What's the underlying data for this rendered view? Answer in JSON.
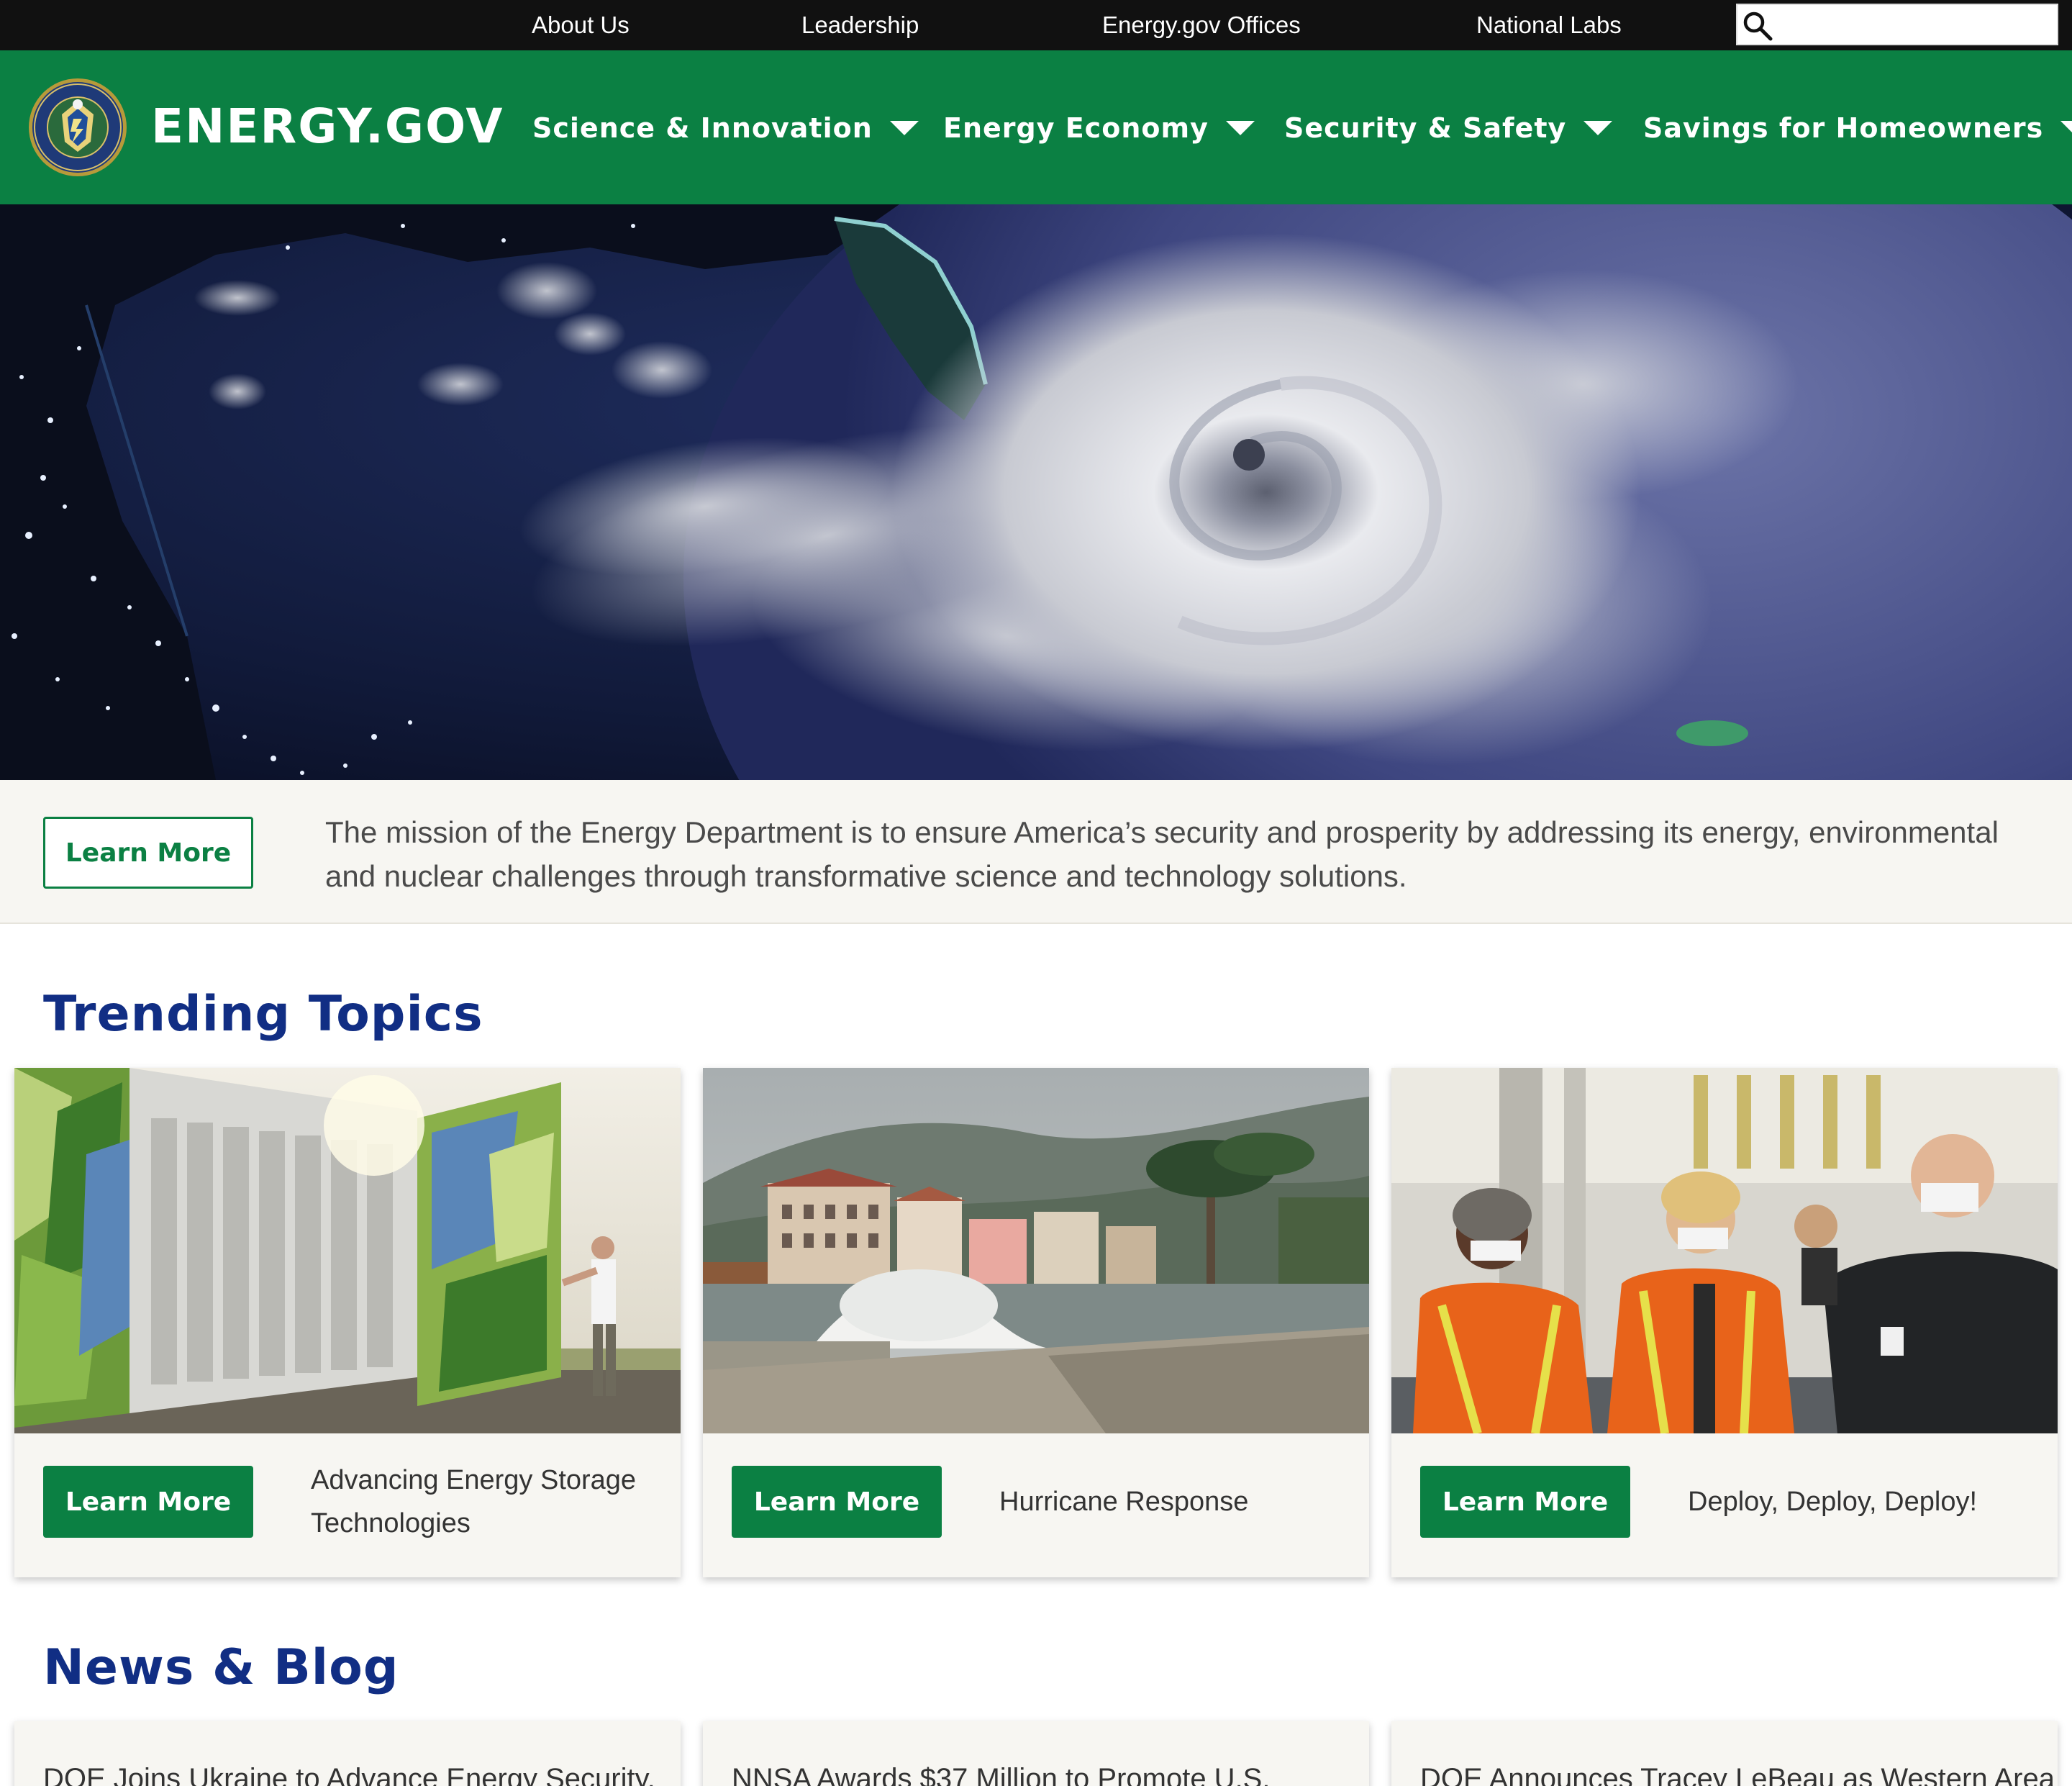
{
  "utility_nav": {
    "items": [
      "About Us",
      "Leadership",
      "Energy.gov Offices",
      "National Labs"
    ],
    "search_placeholder": ""
  },
  "header": {
    "site_title": "ENERGY.GOV",
    "nav": [
      "Science & Innovation",
      "Energy Economy",
      "Security & Safety",
      "Savings for Homeowners"
    ]
  },
  "mission": {
    "button_label": "Learn More",
    "text": "The mission of the Energy Department is to ensure America’s security and prosperity by addressing its energy, environmental and nuclear challenges through transformative science and technology solutions."
  },
  "trending": {
    "heading": "Trending Topics",
    "cards": [
      {
        "button_label": "Learn More",
        "title": "Advancing Energy Storage Technologies"
      },
      {
        "button_label": "Learn More",
        "title": "Hurricane Response"
      },
      {
        "button_label": "Learn More",
        "title": "Deploy, Deploy, Deploy!"
      }
    ]
  },
  "news": {
    "heading": "News & Blog",
    "items": [
      {
        "title": "DOE Joins Ukraine to Advance Energy Security,"
      },
      {
        "title": "NNSA Awards $37 Million to Promote U.S."
      },
      {
        "title": "DOE Announces Tracey LeBeau as Western Area"
      }
    ]
  },
  "colors": {
    "utility_bar": "#111111",
    "brand_green": "#0b8043",
    "heading_navy": "#112e84",
    "band_background": "#f7f6f2"
  },
  "icons": [
    "search-icon",
    "doe-seal-logo",
    "chevron-down-icon"
  ]
}
